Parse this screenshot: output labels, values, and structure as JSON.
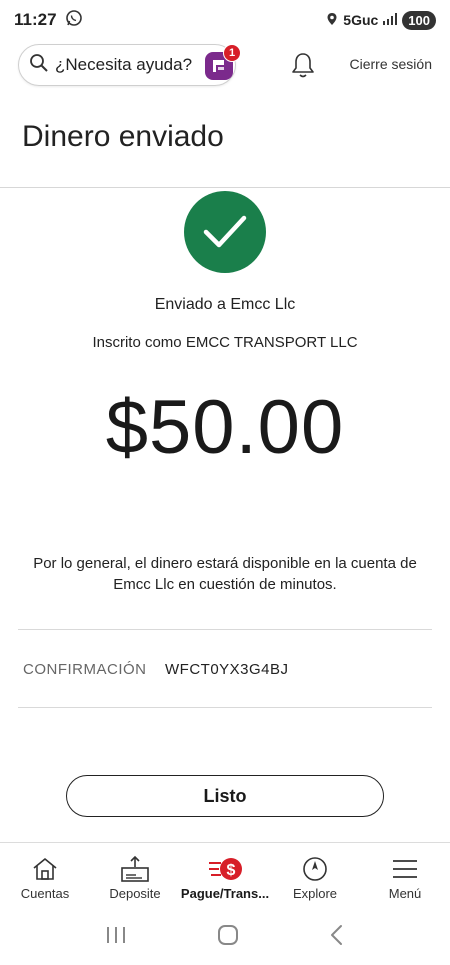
{
  "status_bar": {
    "time": "11:27",
    "network": "5Guc",
    "battery": "100"
  },
  "top_bar": {
    "search_placeholder": "¿Necesita ayuda?",
    "fargo_badge_count": "1",
    "logout_label": "Cierre sesión"
  },
  "page": {
    "title": "Dinero enviado"
  },
  "confirmation": {
    "sent_to": "Enviado a Emcc Llc",
    "enrolled_as": "Inscrito como EMCC TRANSPORT LLC",
    "amount": "$50.00",
    "notice": "Por lo general, el dinero estará disponible en la cuenta de Emcc Llc en cuestión de minutos.",
    "confirmation_label": "CONFIRMACIÓN",
    "confirmation_code": "WFCT0YX3G4BJ",
    "done_label": "Listo"
  },
  "bottom_nav": {
    "items": [
      {
        "label": "Cuentas",
        "icon": "home-icon"
      },
      {
        "label": "Deposite",
        "icon": "deposit-check-icon"
      },
      {
        "label": "Pague/Trans...",
        "icon": "pay-transfer-icon"
      },
      {
        "label": "Explore",
        "icon": "compass-icon"
      },
      {
        "label": "Menú",
        "icon": "hamburger-icon"
      }
    ],
    "active_index": 2
  },
  "colors": {
    "success_green": "#1a7f4b",
    "brand_red": "#d71e28",
    "fargo_purple": "#7b2a8c"
  }
}
